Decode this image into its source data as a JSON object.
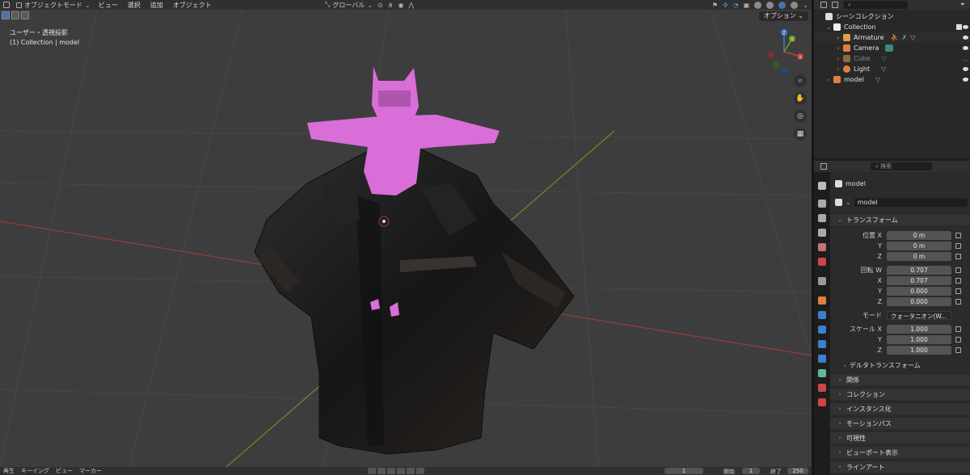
{
  "header": {
    "mode_label": "オブジェクトモード",
    "menu": [
      "ビュー",
      "選択",
      "追加",
      "オブジェクト"
    ],
    "transform_orientation": "グローバル",
    "option_label": "オプション"
  },
  "viewport": {
    "view_label": "ユーザー・透視投影",
    "context_label": "(1) Collection | model",
    "gizmo_axes": [
      "X",
      "Y",
      "Z"
    ]
  },
  "timeline": {
    "menu": [
      "再生",
      "キーイング",
      "ビュー",
      "マーカー"
    ],
    "current_frame": "1",
    "start_label": "開始",
    "start_value": "1",
    "end_label": "終了",
    "end_value": "250"
  },
  "outliner": {
    "search_placeholder": "",
    "scene_collection": "シーンコレクション",
    "collection": "Collection",
    "items": [
      {
        "label": "Armature"
      },
      {
        "label": "Camera"
      },
      {
        "label": "Cube"
      },
      {
        "label": "Light"
      }
    ],
    "model": "model"
  },
  "properties": {
    "search_placeholder": "検索",
    "object_name": "model",
    "datablock_name": "model",
    "transform_title": "トランスフォーム",
    "location_label": "位置 X",
    "axis_y": "Y",
    "axis_z": "Z",
    "axis_x": "X",
    "location": [
      "0 m",
      "0 m",
      "0 m"
    ],
    "rotation_label": "回転 W",
    "rotation": [
      "0.707",
      "0.707",
      "0.000",
      "0.000"
    ],
    "mode_label": "モード",
    "mode_value": "クォータニオン(W...",
    "scale_label": "スケール X",
    "scale": [
      "1.000",
      "1.000",
      "1.000"
    ],
    "delta_transform": "デルタトランスフォーム",
    "sections": [
      "関係",
      "コレクション",
      "インスタンス化",
      "モーションパス",
      "可視性",
      "ビューポート表示",
      "ラインアート"
    ]
  },
  "colors": {
    "accent": "#4772b3",
    "viewport_bg": "#3d3d3d",
    "character_pink": "#d96ed9",
    "jacket": "#1e1e1e"
  }
}
